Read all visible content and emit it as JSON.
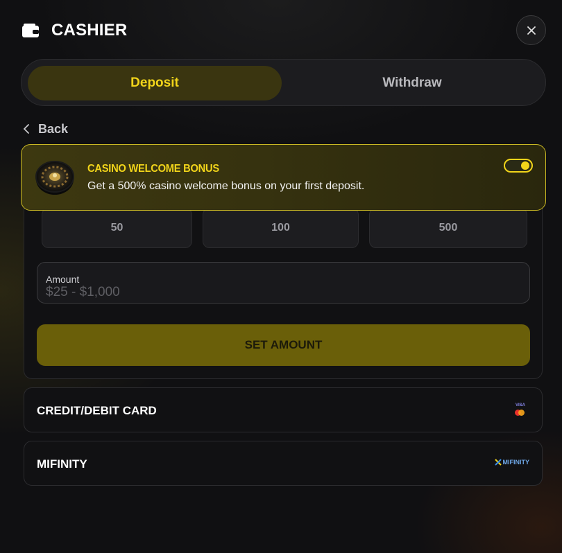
{
  "header": {
    "title": "CASHIER"
  },
  "tabs": [
    {
      "label": "Deposit",
      "active": true
    },
    {
      "label": "Withdraw",
      "active": false
    }
  ],
  "back": {
    "label": "Back"
  },
  "bonus": {
    "title": "CASINO WELCOME BONUS",
    "description": "Get a 500% casino welcome bonus on your first deposit.",
    "enabled": true
  },
  "presets": [
    {
      "label": "50"
    },
    {
      "label": "100"
    },
    {
      "label": "500"
    }
  ],
  "amount": {
    "label": "Amount",
    "placeholder": "$25 - $1,000"
  },
  "set_amount_label": "SET AMOUNT",
  "methods": [
    {
      "label": "CREDIT/DEBIT CARD",
      "logo": "visa-mastercard",
      "logo_text": "VISA"
    },
    {
      "label": "MIFINITY",
      "logo": "mifinity",
      "logo_text": "MIFINITY"
    }
  ],
  "colors": {
    "accent": "#f2d51a",
    "background": "#101012"
  }
}
